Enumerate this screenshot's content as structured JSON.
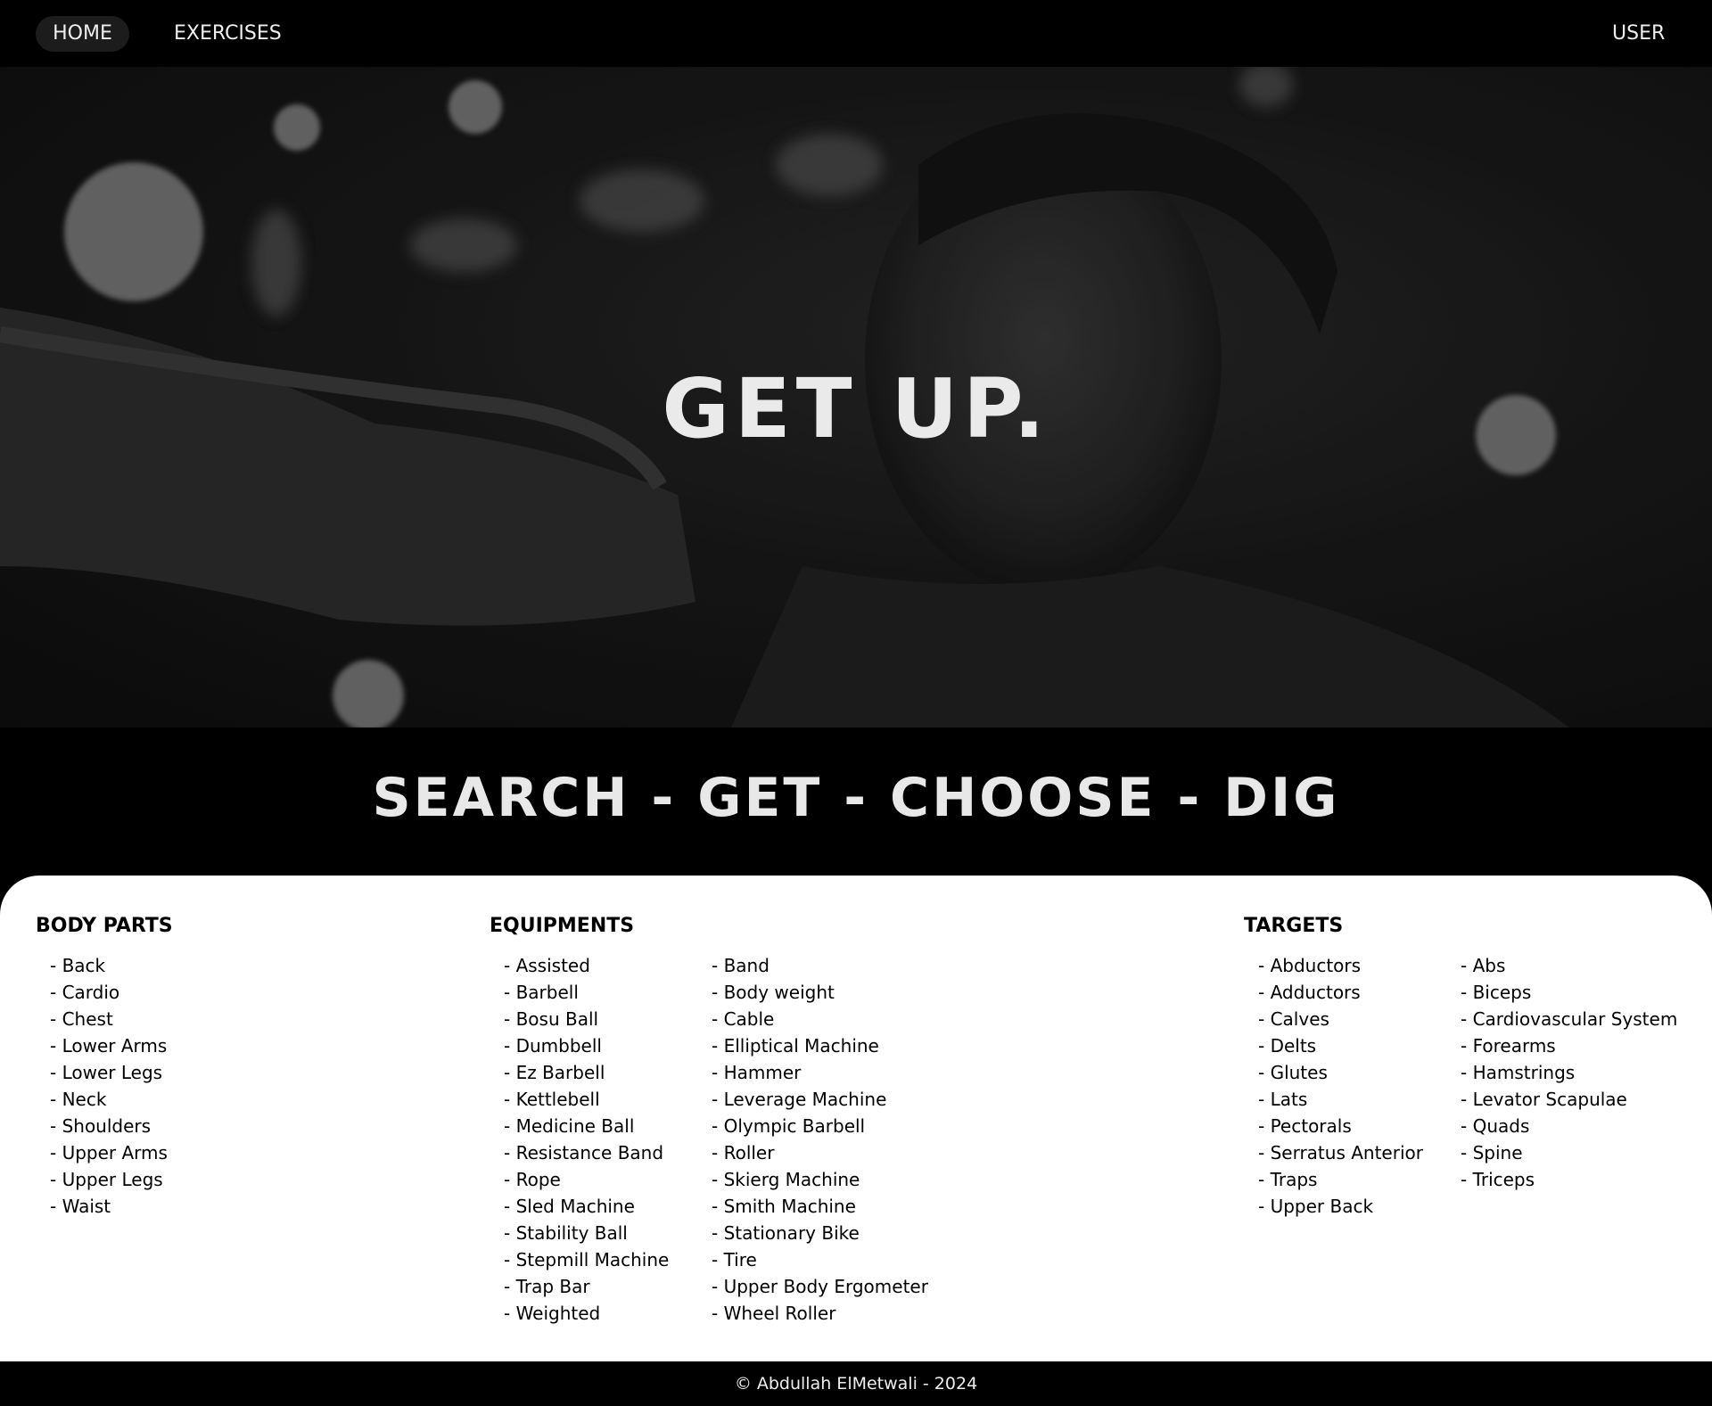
{
  "nav": {
    "home": "HOME",
    "exercises": "EXERCISES",
    "user": "USER"
  },
  "hero": {
    "title": "GET UP."
  },
  "tagline": "SEARCH - GET - CHOOSE - DIG",
  "body_parts": {
    "title": "BODY PARTS",
    "items": [
      "Back",
      "Cardio",
      "Chest",
      "Lower Arms",
      "Lower Legs",
      "Neck",
      "Shoulders",
      "Upper Arms",
      "Upper Legs",
      "Waist"
    ]
  },
  "equipments": {
    "title": "EQUIPMENTS",
    "col1": [
      "Assisted",
      "Barbell",
      "Bosu Ball",
      "Dumbbell",
      "Ez Barbell",
      "Kettlebell",
      "Medicine Ball",
      "Resistance Band",
      "Rope",
      "Sled Machine",
      "Stability Ball",
      "Stepmill Machine",
      "Trap Bar",
      "Weighted"
    ],
    "col2": [
      "Band",
      "Body weight",
      "Cable",
      "Elliptical Machine",
      "Hammer",
      "Leverage Machine",
      "Olympic Barbell",
      "Roller",
      "Skierg Machine",
      "Smith Machine",
      "Stationary Bike",
      "Tire",
      "Upper Body Ergometer",
      "Wheel Roller"
    ]
  },
  "targets": {
    "title": "TARGETS",
    "col1": [
      "Abductors",
      "Adductors",
      "Calves",
      "Delts",
      "Glutes",
      "Lats",
      "Pectorals",
      "Serratus Anterior",
      "Traps",
      "Upper Back"
    ],
    "col2": [
      "Abs",
      "Biceps",
      "Cardiovascular System",
      "Forearms",
      "Hamstrings",
      "Levator Scapulae",
      "Quads",
      "Spine",
      "Triceps"
    ]
  },
  "footer": "© Abdullah ElMetwali - 2024"
}
